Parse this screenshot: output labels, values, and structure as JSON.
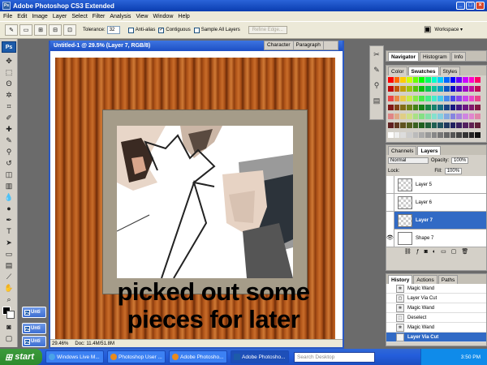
{
  "app": {
    "title": "Adobe Photoshop CS3 Extended",
    "logo": "Ps",
    "window_buttons": [
      "_",
      "□",
      "×"
    ]
  },
  "menu": [
    "File",
    "Edit",
    "Image",
    "Layer",
    "Select",
    "Filter",
    "Analysis",
    "View",
    "Window",
    "Help"
  ],
  "options": {
    "tolerance_label": "Tolerance:",
    "tolerance_value": "32",
    "antialias_label": "Anti-alias",
    "contiguous_label": "Contiguous",
    "sample_all_label": "Sample All Layers",
    "refine_edge_label": "Refine Edge...",
    "workspace_label": "Workspace ▾",
    "tool_icon": "magic-wand-icon"
  },
  "document": {
    "title": "Untitled-1 @ 29.5% (Layer 7, RGB/8)",
    "caption_line1": "picked out some",
    "caption_line2": "pieces for later",
    "zoom": "29.46%",
    "doc_size": "Doc: 11.4M/51.8M"
  },
  "minimized_windows": [
    "Unti",
    "Unti",
    "Unti"
  ],
  "char_panel_tabs": [
    "Character",
    "Paragraph"
  ],
  "nav_tabs": [
    "Navigator",
    "Histogram",
    "Info"
  ],
  "swatch_tabs": [
    "Color",
    "Swatches",
    "Styles"
  ],
  "layers": {
    "tabs": [
      "Channels",
      "Layers"
    ],
    "blend_mode": "Normal",
    "opacity_label": "Opacity:",
    "opacity": "100%",
    "lock_label": "Lock:",
    "fill_label": "Fill:",
    "fill": "100%",
    "items": [
      {
        "name": "Layer 5",
        "selected": false,
        "visible": false
      },
      {
        "name": "Layer 6",
        "selected": false,
        "visible": false
      },
      {
        "name": "Layer 7",
        "selected": true,
        "visible": false
      },
      {
        "name": "Shape 7",
        "selected": false,
        "visible": true
      }
    ]
  },
  "history": {
    "tabs": [
      "History",
      "Actions",
      "Paths"
    ],
    "items": [
      {
        "label": "Magic Wand",
        "selected": false
      },
      {
        "label": "Layer Via Cut",
        "selected": false
      },
      {
        "label": "Magic Wand",
        "selected": false
      },
      {
        "label": "Deselect",
        "selected": false
      },
      {
        "label": "Magic Wand",
        "selected": false
      },
      {
        "label": "Layer Via Cut",
        "selected": true
      }
    ]
  },
  "taskbar": {
    "start": "start",
    "buttons": [
      {
        "label": "Windows Live M...",
        "active": false
      },
      {
        "label": "Photoshop User ...",
        "active": false
      },
      {
        "label": "Adobe Photosho...",
        "active": false
      },
      {
        "label": "Adobe Photosho...",
        "active": true
      }
    ],
    "search_placeholder": "Search Desktop",
    "clock": "3:50 PM"
  },
  "colors": {
    "titlebar": "#0a3db0",
    "selection": "#316ac5",
    "start_green": "#2d8a2d"
  }
}
